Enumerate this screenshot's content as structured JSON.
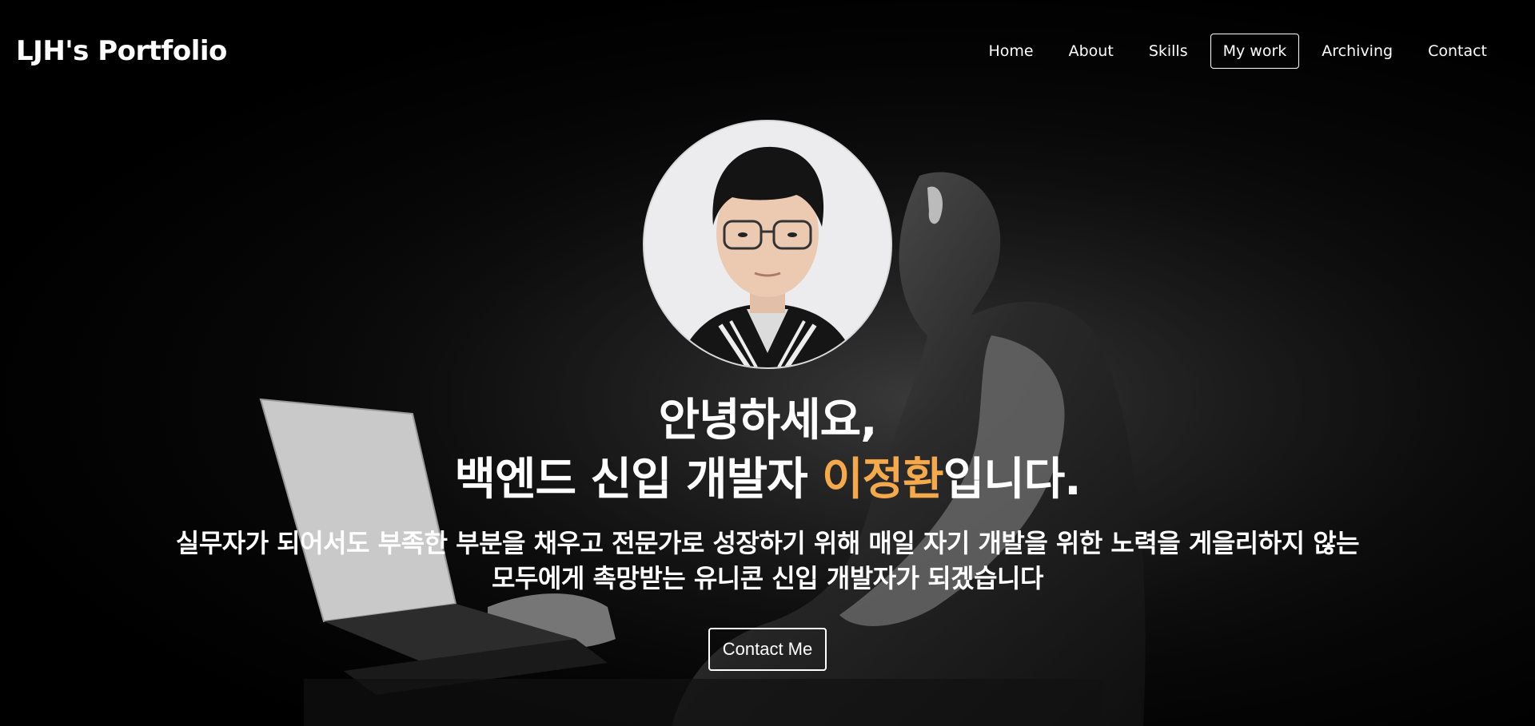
{
  "header": {
    "logo": "LJH's Portfolio",
    "nav": [
      {
        "label": "Home",
        "active": false
      },
      {
        "label": "About",
        "active": false
      },
      {
        "label": "Skills",
        "active": false
      },
      {
        "label": "My work",
        "active": true
      },
      {
        "label": "Archiving",
        "active": false
      },
      {
        "label": "Contact",
        "active": false
      }
    ]
  },
  "hero": {
    "greeting": "안녕하세요,",
    "intro_prefix": "백엔드 신입 개발자 ",
    "name": "이정환",
    "intro_suffix": "입니다.",
    "description_line1": "실무자가 되어서도 부족한 부분을 채우고 전문가로 성장하기 위해 매일 자기 개발을 위한 노력을 게을리하지 않는",
    "description_line2": "모두에게 촉망받는 유니콘 신입 개발자가 되겠습니다",
    "cta_label": "Contact Me"
  },
  "colors": {
    "background": "#000000",
    "text": "#ffffff",
    "accent": "#f5a94a"
  }
}
